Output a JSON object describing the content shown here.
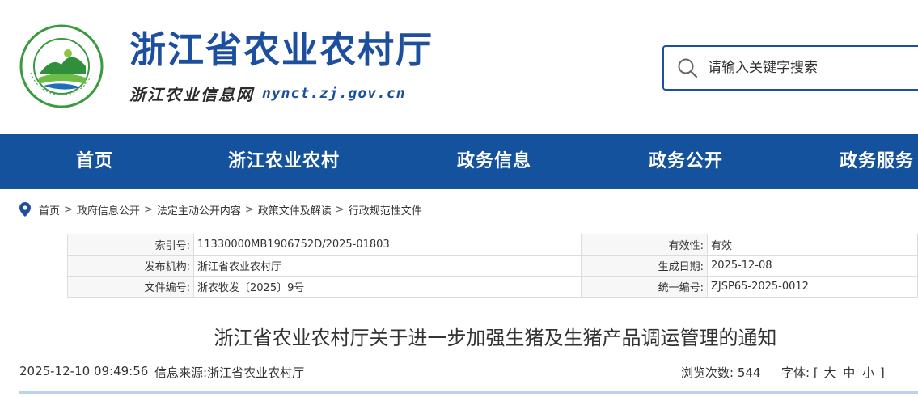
{
  "header": {
    "title": "浙江省农业农村厅",
    "subtitle": "浙江农业信息网",
    "domain": "nynct.zj.gov.cn",
    "logo_text": "浙江省农业农村厅",
    "search_placeholder": "请输入关键字搜索"
  },
  "nav": {
    "items": [
      {
        "label": "首页"
      },
      {
        "label": "浙江农业农村"
      },
      {
        "label": "政务信息"
      },
      {
        "label": "政务公开"
      },
      {
        "label": "政务服务"
      }
    ]
  },
  "breadcrumb": {
    "items": [
      "首页",
      "政府信息公开",
      "法定主动公开内容",
      "政策文件及解读",
      "行政规范性文件"
    ],
    "separator": ">"
  },
  "info": {
    "index_label": "索引号:",
    "index_value": "11330000MB1906752D/2025-01803",
    "validity_label": "有效性:",
    "validity_value": "有效",
    "publisher_label": "发布机构:",
    "publisher_value": "浙江省农业农村厅",
    "created_label": "生成日期:",
    "created_value": "2025-12-08",
    "docnum_label": "文件编号:",
    "docnum_value": "浙农牧发〔2025〕9号",
    "unified_label": "统一编号:",
    "unified_value": "ZJSP65-2025-0012"
  },
  "article": {
    "title": "浙江省农业农村厅关于进一步加强生猪及生猪产品调运管理的通知",
    "datetime": "2025-12-10 09:49:56",
    "source_label": "信息来源:",
    "source_value": "浙江省农业农村厅",
    "views_label": "浏览次数:",
    "views_value": "544",
    "font_label": "字体:",
    "font_open": "[",
    "font_large": "大",
    "font_medium": "中",
    "font_small": "小",
    "font_close": "]"
  },
  "colors": {
    "brand_blue": "#1d4f9f",
    "nav_blue": "#14529e",
    "logo_green": "#3a9a3e"
  }
}
